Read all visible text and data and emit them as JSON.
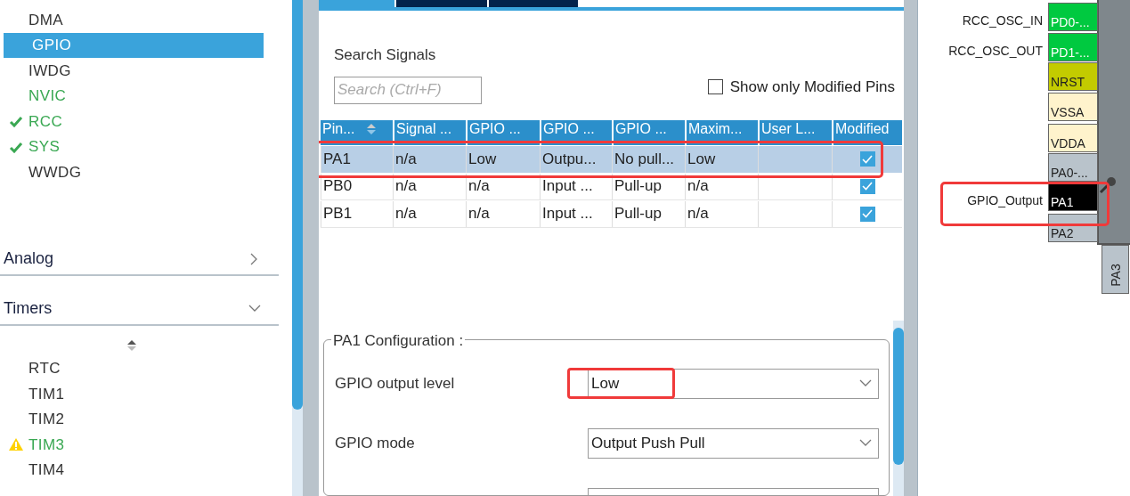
{
  "sidebar": {
    "items": [
      {
        "label": "DMA",
        "selected": false,
        "enabled": false,
        "configured": false,
        "warning": false
      },
      {
        "label": "GPIO",
        "selected": true,
        "enabled": false,
        "configured": false,
        "warning": false
      },
      {
        "label": "IWDG",
        "selected": false,
        "enabled": false,
        "configured": false,
        "warning": false
      },
      {
        "label": "NVIC",
        "selected": false,
        "enabled": true,
        "configured": false,
        "warning": false
      },
      {
        "label": "RCC",
        "selected": false,
        "enabled": true,
        "configured": true,
        "warning": false
      },
      {
        "label": "SYS",
        "selected": false,
        "enabled": true,
        "configured": true,
        "warning": false
      },
      {
        "label": "WWDG",
        "selected": false,
        "enabled": false,
        "configured": false,
        "warning": false
      }
    ],
    "categories": [
      {
        "label": "Analog",
        "expanded": false
      },
      {
        "label": "Timers",
        "expanded": true
      }
    ],
    "timer_items": [
      {
        "label": "RTC",
        "selected": false,
        "enabled": false,
        "configured": false,
        "warning": false
      },
      {
        "label": "TIM1",
        "selected": false,
        "enabled": false,
        "configured": false,
        "warning": false
      },
      {
        "label": "TIM2",
        "selected": false,
        "enabled": false,
        "configured": false,
        "warning": false
      },
      {
        "label": "TIM3",
        "selected": false,
        "enabled": true,
        "configured": false,
        "warning": true
      },
      {
        "label": "TIM4",
        "selected": false,
        "enabled": false,
        "configured": false,
        "warning": false
      }
    ]
  },
  "tabs": [
    {
      "selected": true
    },
    {
      "selected": false
    },
    {
      "selected": false
    }
  ],
  "search": {
    "label": "Search Signals",
    "placeholder": "Search (Ctrl+F)"
  },
  "show_modified": {
    "label": "Show only Modified Pins",
    "checked": false
  },
  "table": {
    "columns": [
      "Pin...",
      "Signal ...",
      "GPIO ...",
      "GPIO ...",
      "GPIO ...",
      "Maxim...",
      "User L...",
      "Modified"
    ],
    "rows": [
      {
        "cells": [
          "PA1",
          "n/a",
          "Low",
          "Outpu...",
          "No pull...",
          "Low",
          ""
        ],
        "modified": true,
        "selected": true
      },
      {
        "cells": [
          "PB0",
          "n/a",
          "n/a",
          "Input ...",
          "Pull-up",
          "n/a",
          ""
        ],
        "modified": true,
        "selected": false
      },
      {
        "cells": [
          "PB1",
          "n/a",
          "n/a",
          "Input ...",
          "Pull-up",
          "n/a",
          ""
        ],
        "modified": true,
        "selected": false
      }
    ]
  },
  "configuration": {
    "title": "PA1 Configuration :",
    "fields": [
      {
        "label": "GPIO output level",
        "value": "Low"
      },
      {
        "label": "GPIO mode",
        "value": "Output Push Pull"
      }
    ]
  },
  "pinout": {
    "pins": [
      {
        "label": "PD0-...",
        "signal": "RCC_OSC_IN",
        "color": "#00c940"
      },
      {
        "label": "PD1-...",
        "signal": "RCC_OSC_OUT",
        "color": "#00c940"
      },
      {
        "label": "NRST",
        "color": "#c3cb00"
      },
      {
        "label": "VSSA",
        "color": "#fff3cc"
      },
      {
        "label": "VDDA",
        "color": "#fff3cc"
      },
      {
        "label": "PA0-...",
        "color": "#b9c3cb"
      },
      {
        "label": "PA1",
        "signal": "GPIO_Output",
        "color": "#000000"
      },
      {
        "label": "PA2",
        "color": "#b9c3cb"
      }
    ],
    "bottom_pins": [
      {
        "label": "PA3",
        "color": "#b9c3cb"
      }
    ]
  }
}
